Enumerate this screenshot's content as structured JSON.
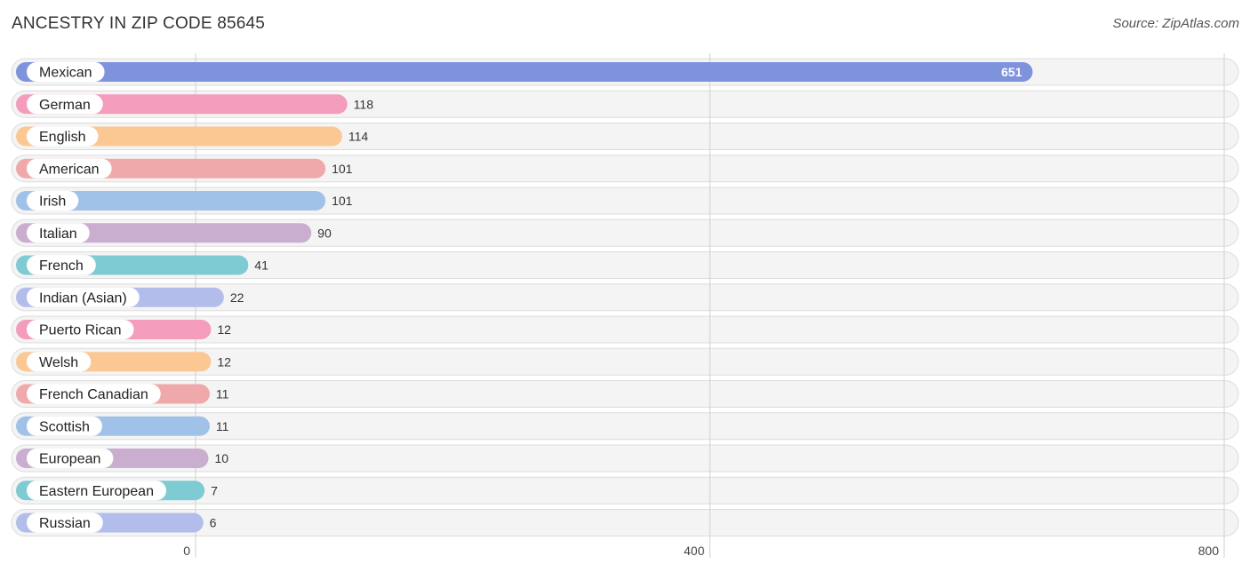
{
  "header": {
    "title": "ANCESTRY IN ZIP CODE 85645",
    "source": "Source: ZipAtlas.com"
  },
  "chart_data": {
    "type": "bar",
    "orientation": "horizontal",
    "title": "ANCESTRY IN ZIP CODE 85645",
    "xlabel": "",
    "ylabel": "",
    "xlim": [
      0,
      800
    ],
    "x_ticks": [
      0,
      400,
      800
    ],
    "grid": true,
    "categories": [
      "Mexican",
      "German",
      "English",
      "American",
      "Irish",
      "Italian",
      "French",
      "Indian (Asian)",
      "Puerto Rican",
      "Welsh",
      "French Canadian",
      "Scottish",
      "European",
      "Eastern European",
      "Russian"
    ],
    "values": [
      651,
      118,
      114,
      101,
      101,
      90,
      41,
      22,
      12,
      12,
      11,
      11,
      10,
      7,
      6
    ],
    "colors": [
      "#7f93dd",
      "#f49cbb",
      "#fbc894",
      "#f0a9aa",
      "#a1c2e8",
      "#c9aed0",
      "#7ecbd4",
      "#b3bdec",
      "#f49cbb",
      "#fbc894",
      "#f0a9aa",
      "#a1c2e8",
      "#c9aed0",
      "#7ecbd4",
      "#b3bdec"
    ]
  }
}
